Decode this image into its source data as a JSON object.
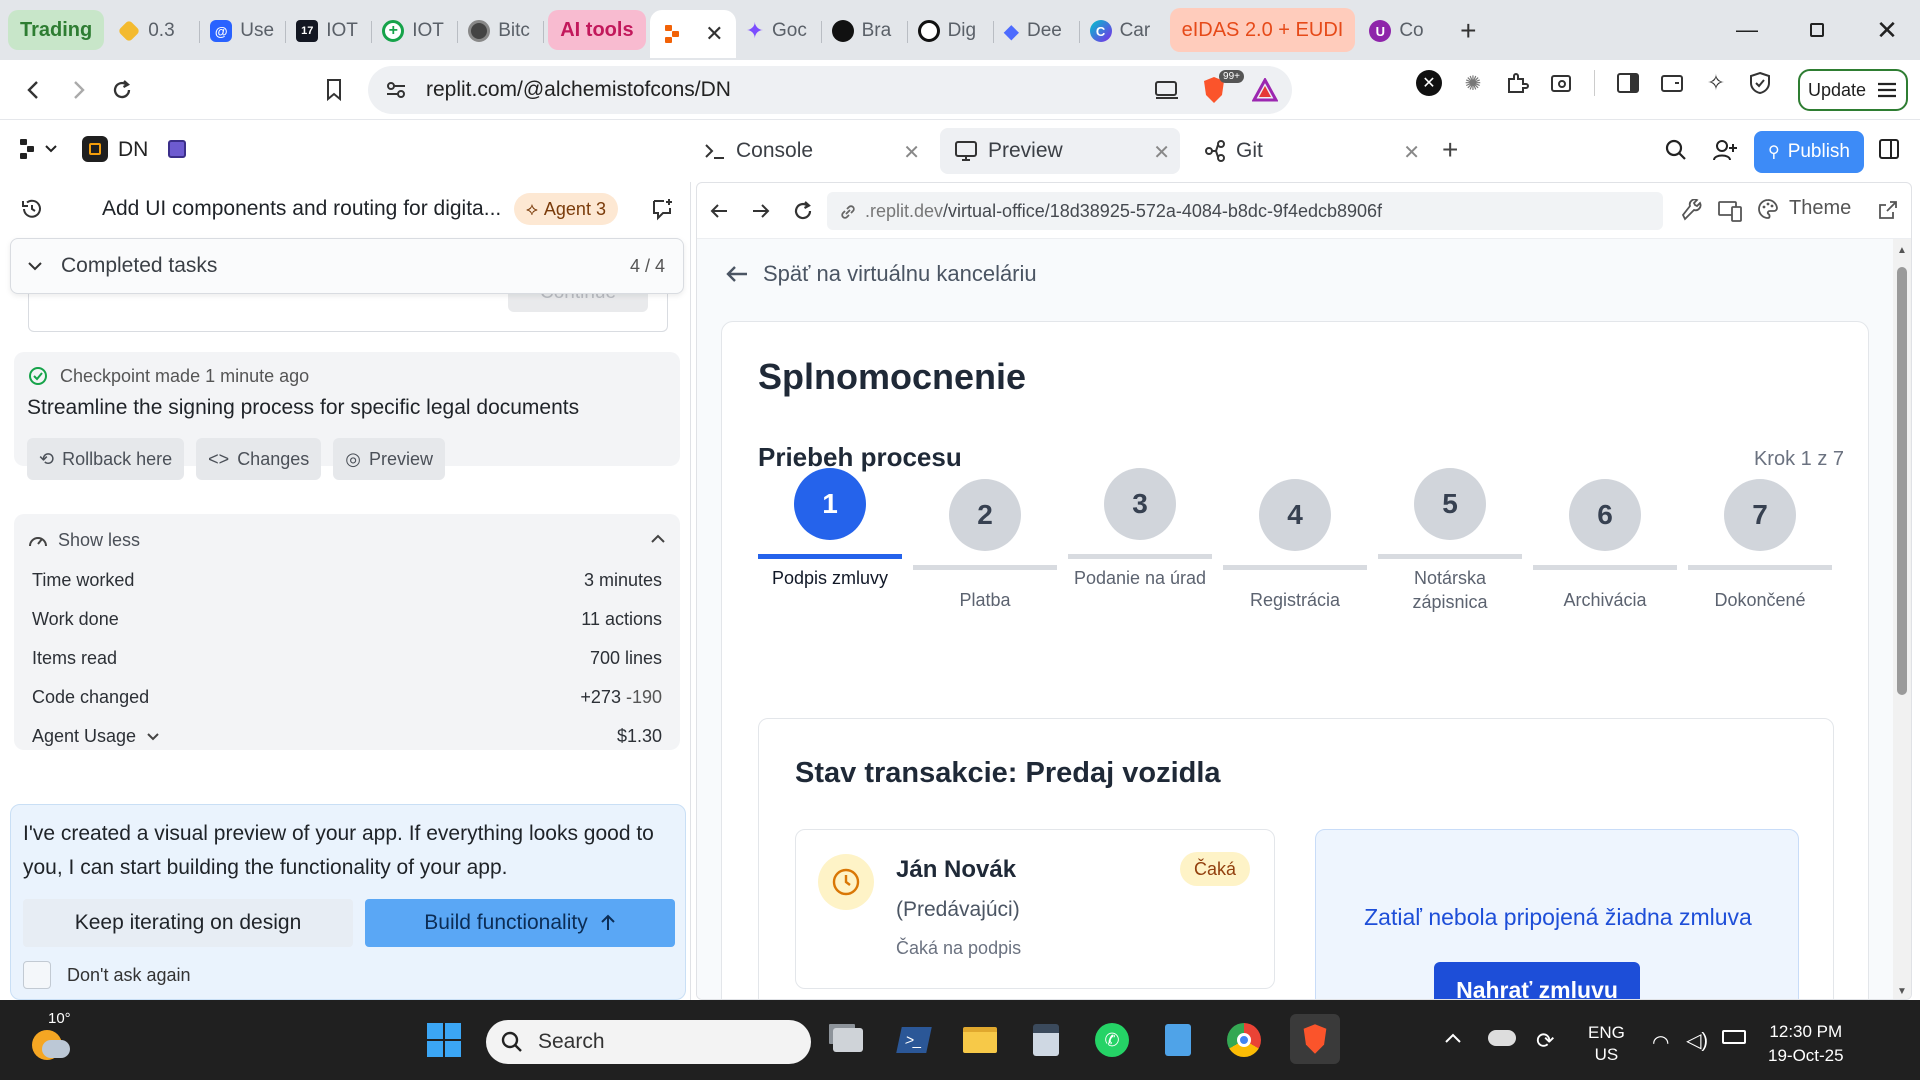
{
  "browser": {
    "tabs": [
      {
        "label": "Trading",
        "type": "group",
        "color": "#c8e6c9",
        "text_color": "#2e7d32"
      },
      {
        "label": "0.3",
        "fav_color": "#f3ba2f"
      },
      {
        "label": "Use",
        "fav_color": "#2962ff"
      },
      {
        "label": "IOT",
        "fav_color": "#131722"
      },
      {
        "label": "IOT",
        "fav_color": "#16a34a"
      },
      {
        "label": "Bitc",
        "fav_color": "#444444"
      },
      {
        "label": "AI tools",
        "type": "group",
        "color": "#f8bbd0",
        "text_color": "#c2185b"
      },
      {
        "label": "",
        "active": true,
        "fav_color": "#f26207"
      },
      {
        "label": "Goc",
        "fav_color": "#7c4dff"
      },
      {
        "label": "Bra",
        "fav_color": "#111111"
      },
      {
        "label": "Dig",
        "fav_color": "#111111"
      },
      {
        "label": "Dee",
        "fav_color": "#4d6bfe"
      },
      {
        "label": "Car",
        "fav_color": "#00a3d7"
      },
      {
        "label": "eIDAS 2.0 + EUDI",
        "type": "group",
        "color": "#ffccbc",
        "text_color": "#e64a19"
      },
      {
        "label": "Co",
        "fav_color": "#8e24aa"
      }
    ],
    "url": "replit.com/@alchemistofcons/DN",
    "update_label": "Update",
    "brave_badge": "99+"
  },
  "replit": {
    "project_name": "DN",
    "tabs": [
      {
        "label": "Console",
        "icon": "terminal-icon"
      },
      {
        "label": "Preview",
        "icon": "monitor-icon",
        "active": true
      },
      {
        "label": "Git",
        "icon": "git-branch-icon"
      }
    ],
    "publish_label": "Publish"
  },
  "agent": {
    "thread_title": "Add UI components and routing for digita...",
    "agent_badge": "Agent 3",
    "completed_tasks_label": "Completed tasks",
    "completed_tasks_count": "4 / 4",
    "faded_button": "Continue",
    "checkpoint": {
      "time_text": "Checkpoint made 1 minute ago",
      "message": "Streamline the signing process for specific legal documents",
      "actions": [
        "Rollback here",
        "Changes",
        "Preview"
      ]
    },
    "stats": {
      "toggle_label": "Show less",
      "rows": [
        {
          "label": "Time worked",
          "value": "3 minutes"
        },
        {
          "label": "Work done",
          "value": "11 actions"
        },
        {
          "label": "Items read",
          "value": "700 lines"
        },
        {
          "label": "Code changed",
          "value_add": "+273",
          "value_del": "-190"
        },
        {
          "label": "Agent Usage",
          "value": "$1.30"
        }
      ]
    },
    "proposal": {
      "text": "I've created a visual preview of your app. If everything looks good to you, I can start building the functionality of your app.",
      "secondary_button": "Keep iterating on design",
      "primary_button": "Build functionality",
      "checkbox_label": "Don't ask again"
    }
  },
  "preview": {
    "url_domain": ".replit.dev",
    "url_path": "/virtual-office/18d38925-572a-4084-b8dc-9f4edcb8906f",
    "theme_label": "Theme",
    "back_link": "Späť na virtuálnu kanceláriu",
    "page_title": "Splnomocnenie",
    "process_title": "Priebeh procesu",
    "step_counter": "Krok 1 z 7",
    "steps": [
      {
        "num": "1",
        "label": "Podpis zmluvy",
        "active": true
      },
      {
        "num": "2",
        "label": "Platba"
      },
      {
        "num": "3",
        "label": "Podanie na úrad"
      },
      {
        "num": "4",
        "label": "Registrácia"
      },
      {
        "num": "5",
        "label": "Notárska zápisnica"
      },
      {
        "num": "6",
        "label": "Archivácia"
      },
      {
        "num": "7",
        "label": "Dokončené"
      }
    ],
    "transaction": {
      "title": "Stav transakcie: Predaj vozidla",
      "party": {
        "name": "Ján Novák",
        "role": "(Predávajúci)",
        "status_text": "Čaká na podpis",
        "badge": "Čaká"
      },
      "contract_empty": "Zatiaľ nebola pripojená žiadna zmluva",
      "upload_button": "Nahrať zmluvu"
    },
    "colors": {
      "accent": "#2563eb",
      "upload_button": "#1d4ed8",
      "badge_bg": "#fef3c7",
      "badge_text": "#92400e"
    }
  },
  "taskbar": {
    "weather_temp": "10°",
    "search_placeholder": "Search",
    "lang": "ENG",
    "region": "US",
    "time": "12:30 PM",
    "date": "19-Oct-25"
  }
}
